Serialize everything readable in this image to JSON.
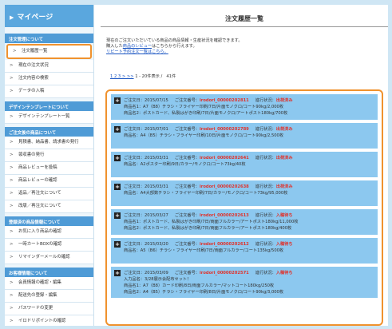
{
  "sidebar": {
    "title": "マイページ",
    "sections": [
      {
        "heading": "注文管理について",
        "items": [
          "注文履歴一覧",
          "現在の注文状況",
          "注文内容の検索",
          "データの入稿"
        ]
      },
      {
        "heading": "デザインテンプレートについて",
        "items": [
          "デザインテンプレート一覧"
        ]
      },
      {
        "heading": "ご注文後の商品について",
        "items": [
          "見積書、納品書、請求書の発行",
          "領収書の発行",
          "商品レビューを投稿",
          "商品レビューの確認",
          "返品／再注文について",
          "改版／再注文について"
        ]
      },
      {
        "heading": "登録済の商品情報について",
        "items": [
          "お気に入り商品の確認",
          "一時カートBOXの確認",
          "リマインダーメールの確認"
        ]
      },
      {
        "heading": "お客様情報について",
        "items": [
          "会員情報の確認・編集",
          "配送先の登録・編集",
          "パスワードの変更",
          "イロドリポイントの確認"
        ]
      }
    ]
  },
  "main": {
    "title": "注文履歴一覧",
    "intro_line1": "現在のご注文いただいている商品の商品情報・生産状況を確認できます。",
    "intro_line2_pre": "購入した",
    "intro_line2_link": "商品のレビュー",
    "intro_line2_post": "はこちらから行えます。",
    "intro_line3_link": "リピート予約注文一覧はこちら。",
    "pager_links": "1 2 3 > >>",
    "pager_text": "1 - 20件表示 /　41件"
  },
  "orders": [
    {
      "date": "ご注文日：2015/07/15",
      "number_label": "ご注文番号：",
      "number": "irodori_00000202811",
      "status_label": "進行状況：",
      "status": "出荷済み",
      "lines": [
        "商品名1：A7（B8）チラシ・フライヤー印刷/7日/片面モノクロ/コート90kg/2,000枚",
        "商品名2：ポストカード、私製はがき印刷/7日/片面モノクロ/アートポスト180kg/700枚"
      ]
    },
    {
      "date": "ご注文日：2015/07/01",
      "number_label": "ご注文番号：",
      "number": "irodori_00000202789",
      "status_label": "進行状況：",
      "status": "出荷済み",
      "lines": [
        "商品名：A4（B5）チラシ・フライヤー印刷/10日/片面モノクロ/コート90kg/2,500枚"
      ]
    },
    {
      "date": "ご注文日：2015/03/31",
      "number_label": "ご注文番号：",
      "number": "irodori_00000202641",
      "status_label": "進行状況：",
      "status": "出荷済み",
      "lines": [
        "商品名：A2ポスター印刷/9日/カラー/モノクロ/コート73kg/40枚"
      ]
    },
    {
      "date": "ご注文日：2015/03/31",
      "number_label": "ご注文番号：",
      "number": "irodori_00000202638",
      "status_label": "進行状況：",
      "status": "出荷済み",
      "lines": [
        "商品名：A4大部数チラシ・フライヤー印刷/7日/カラー/モノクロ/コート73kg/95,000枚"
      ]
    },
    {
      "date": "ご注文日：2015/03/27",
      "number_label": "ご注文番号：",
      "number": "irodori_00000202613",
      "status_label": "進行状況：",
      "status": "入稿待ち",
      "lines": [
        "商品名1：ポストカード、私製はがき印刷/7日/両面フルカラー/アートポスト180kg/11,000枚",
        "商品名2：ポストカード、私製はがき印刷/7日/両面フルカラー/アートポスト180kg/400枚"
      ]
    },
    {
      "date": "ご注文日：2015/03/20",
      "number_label": "ご注文番号：",
      "number": "irodori_00000202612",
      "status_label": "進行状況：",
      "status": "入稿待ち",
      "lines": [
        "商品名：A5（B6）チラシ・フライヤー印刷/7日/両面フルカラー/コート135kg/500枚"
      ]
    },
    {
      "date": "ご注文日：2015/03/09",
      "number_label": "ご注文番号：",
      "number": "irodori_00000202571",
      "status_label": "進行状況：",
      "status": "入稿待ち",
      "lines": [
        "入力品名：3/28展示会配布セット！",
        "商品名1：A7（B8）カード印刷/8日/両面フルカラー/マットコート180kg/250枚",
        "商品名2：A4（B5）チラシ・フライヤー印刷/8日/片面モノクロ/コート90kg/3,000枚"
      ]
    }
  ]
}
